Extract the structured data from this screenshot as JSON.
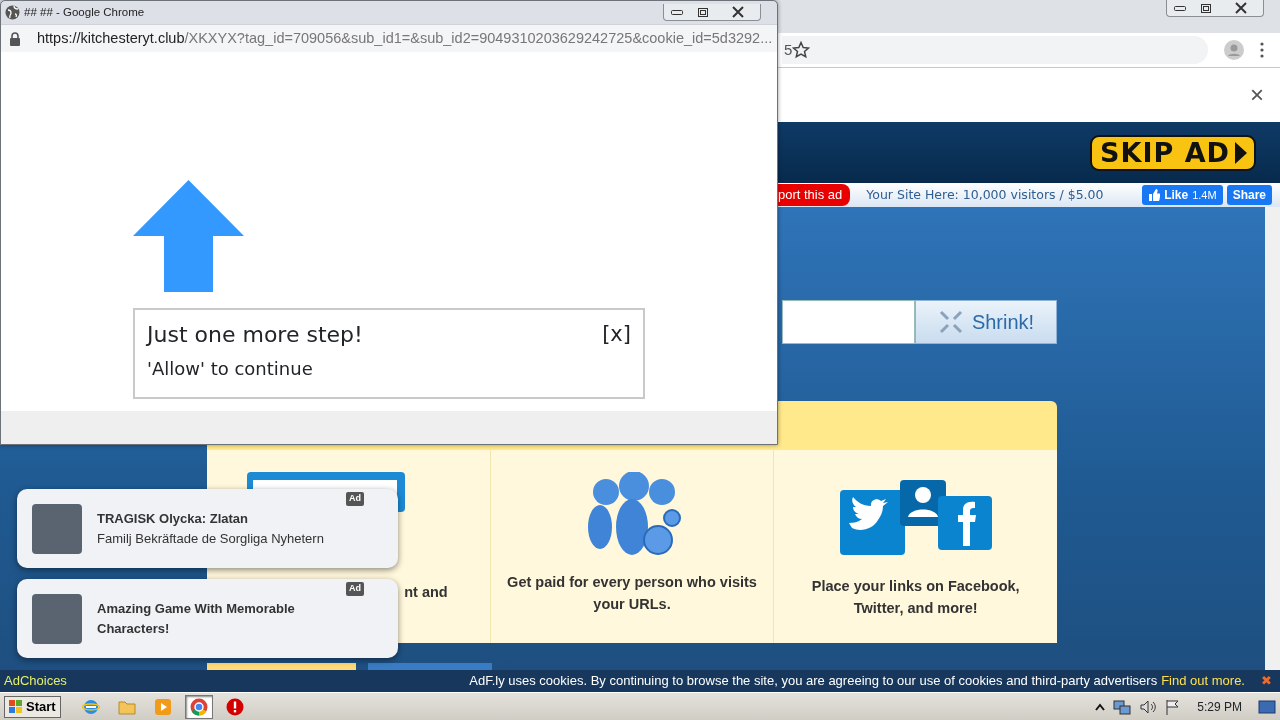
{
  "browser": {
    "address_tail": "5",
    "infobar_close": "×"
  },
  "ad_header": {
    "skip_button": "SKIP AD"
  },
  "ad_bar": {
    "report": "port this ad",
    "promo": "Your Site Here: 10,000 visitors / $5.00",
    "like": "Like",
    "like_count": "1.4M",
    "share": "Share"
  },
  "shrink": {
    "button": "Shrink!"
  },
  "features": [
    {
      "kind": "url",
      "text": "nt and"
    },
    {
      "kind": "money",
      "text": "Get paid for every person who visits your URLs."
    },
    {
      "kind": "social",
      "text": "Place your links on Facebook, Twitter, and more!"
    }
  ],
  "popup": {
    "title": "## ## - Google Chrome",
    "url_host": "https://kitchesteryt.club",
    "url_path": "/XKXYX?tag_id=709056&sub_id1=&sub_id2=9049310203629242725&cookie_id=5d3292...",
    "heading": "Just one more step!",
    "close": "[x]",
    "message": "'Allow' to continue"
  },
  "notifications": [
    {
      "badge": "Ad",
      "title": "TRAGISK Olycka: Zlatan",
      "body": "Familj Bekräftade de Sorgliga Nyhetern"
    },
    {
      "badge": "Ad",
      "title": "Amazing Game With Memorable Characters!"
    }
  ],
  "cookie_bar": {
    "adchoices": "AdChoices",
    "message": "AdF.ly uses cookies. By continuing to browse the site, you are agreeing to our use of cookies and third-party advertisers",
    "link": "Find out more.",
    "close": "✖"
  },
  "taskbar": {
    "start": "Start",
    "apps": [
      {
        "kind": "ie",
        "selected": false
      },
      {
        "kind": "folder",
        "selected": false
      },
      {
        "kind": "media",
        "selected": false
      },
      {
        "kind": "chrome",
        "selected": true
      },
      {
        "kind": "stop",
        "selected": false
      }
    ],
    "clock": "5:29 PM"
  }
}
